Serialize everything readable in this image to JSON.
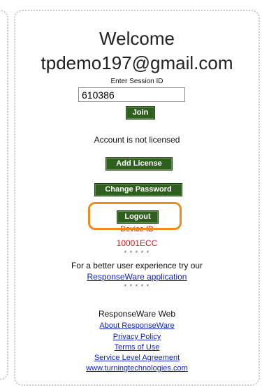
{
  "welcome": {
    "title": "Welcome",
    "email": "tpdemo197@gmail.com"
  },
  "session": {
    "label": "Enter Session ID",
    "value": "610386",
    "join_label": "Join"
  },
  "account": {
    "status": "Account is not licensed",
    "add_license_label": "Add License",
    "change_password_label": "Change Password",
    "logout_label": "Logout"
  },
  "device": {
    "label": "Device ID",
    "id": "10001ECC"
  },
  "promo": {
    "stars": "* * * * *",
    "text": "For a better user experience try our",
    "link": "ResponseWare application"
  },
  "footer": {
    "title": "ResponseWare Web",
    "links": [
      "About ResponseWare",
      "Privacy Policy",
      "Terms of Use",
      "Service Level Agreement",
      "www.turningtechnologies.com"
    ]
  },
  "colors": {
    "button_green": "#2f5f1e",
    "device_red": "#dd1111",
    "link_blue": "#1122cc",
    "highlight_orange": "#f08a1c"
  }
}
